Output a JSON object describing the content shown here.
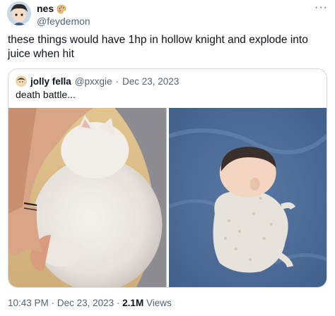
{
  "author": {
    "display_name": "nes",
    "handle": "@feydemon",
    "name_emoji": "palette-icon"
  },
  "tweet": {
    "text": "these things would have 1hp in hollow knight and explode into juice when hit"
  },
  "quote": {
    "display_name": "jolly fella",
    "handle": "@pxxgie",
    "separator": "·",
    "date": "Dec 23, 2023",
    "text": "death battle...",
    "images": [
      {
        "name": "chubby-white-cat-photo"
      },
      {
        "name": "sleeping-baby-photo"
      }
    ]
  },
  "footer": {
    "time": "10:43 PM",
    "separator": "·",
    "date": "Dec 23, 2023",
    "views_count": "2.1M",
    "views_label": "Views"
  },
  "more_icon": "more-horizontal-icon"
}
